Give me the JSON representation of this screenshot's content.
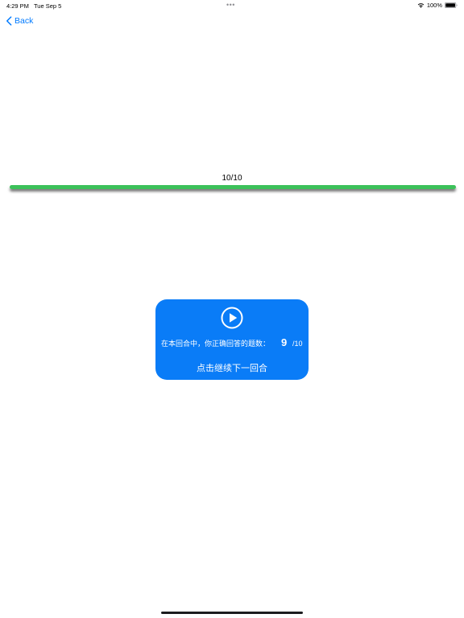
{
  "status_bar": {
    "time": "4:29 PM",
    "date": "Tue Sep 5",
    "dots": "•••",
    "battery_percent": "100%",
    "wifi_icon": "wifi-icon",
    "battery_icon": "battery-full-icon"
  },
  "nav": {
    "back_label": "Back",
    "back_icon": "chevron-left-icon"
  },
  "progress": {
    "label": "10/10",
    "fraction": 1.0,
    "fill_color": "#3cc15a"
  },
  "result_card": {
    "play_icon": "play-circle-icon",
    "score_label": "在本回合中，你正确回答的题数：",
    "score_value": "9",
    "score_total": "/10",
    "continue_label": "点击继续下一回合",
    "background_color": "#0a7cf7"
  },
  "colors": {
    "accent": "#007aff"
  }
}
